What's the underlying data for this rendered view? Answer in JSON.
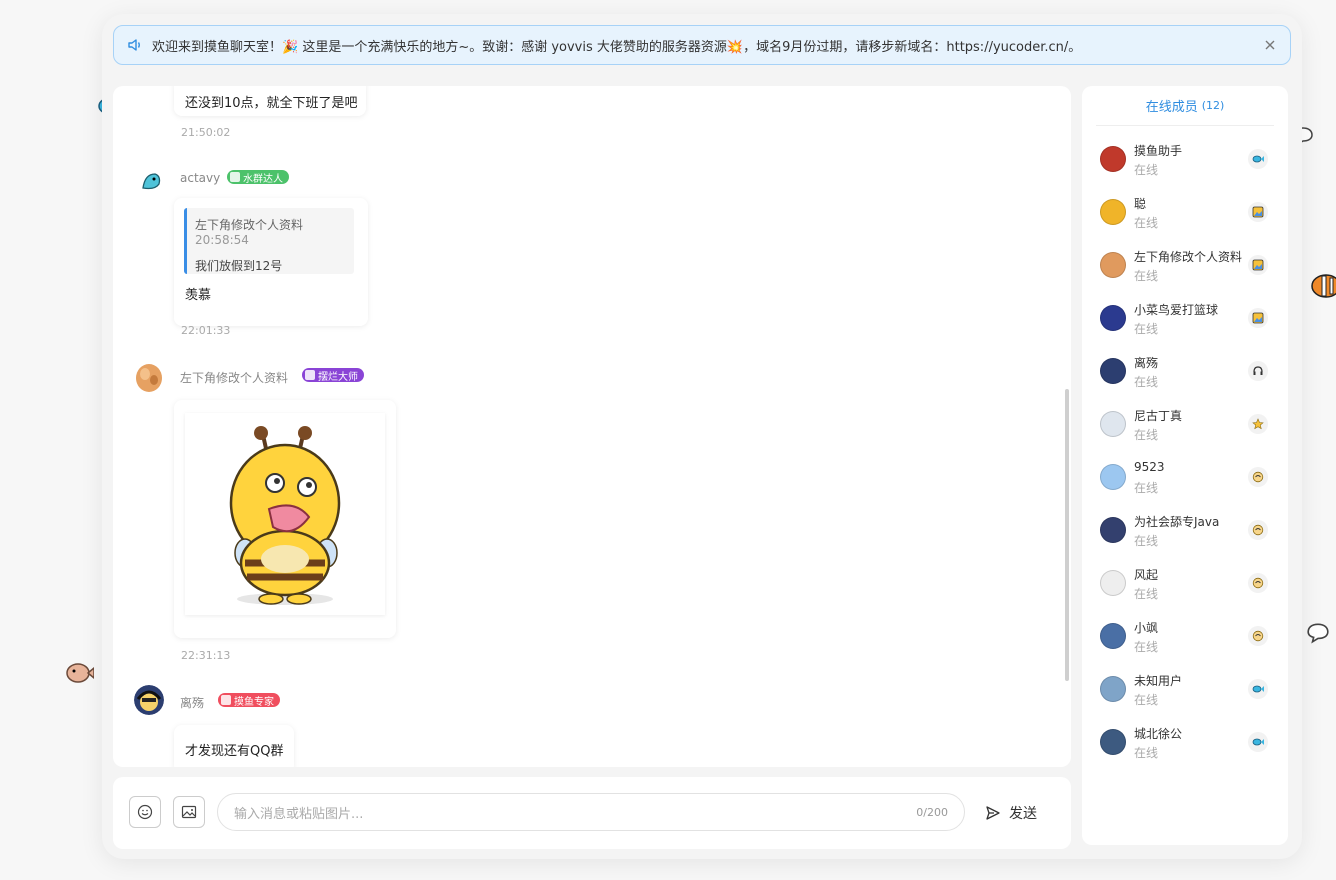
{
  "notice": {
    "text": "欢迎来到摸鱼聊天室！🎉 这里是一个充满快乐的地方~。致谢：感谢 yovvis 大佬赞助的服务器资源💥，域名9月份过期，请移步新域名：https://yucoder.cn/。"
  },
  "messages": {
    "m1": {
      "text": "还没到10点，就全下班了是吧",
      "time": "21:50:02"
    },
    "m2": {
      "user": "actavy",
      "badge": "水群达人",
      "badge_color": "#4cc26a",
      "quote_user": "左下角修改个人资料",
      "quote_time": "20:58:54",
      "quote_text": "我们放假到12号",
      "text": "羡慕",
      "time": "22:01:33"
    },
    "m3": {
      "user": "左下角修改个人资料",
      "badge": "摆烂大师",
      "badge_color": "#8a44d6",
      "image": "bee-sticker",
      "time": "22:31:13"
    },
    "m4": {
      "user": "离殇",
      "badge": "摸鱼专家",
      "badge_color": "#f04e5e",
      "text": "才发现还有QQ群"
    }
  },
  "composer": {
    "placeholder": "输入消息或粘贴图片...",
    "counter": "0/200",
    "send_label": "发送"
  },
  "members": {
    "title": "在线成员",
    "count": "(12)",
    "list": [
      {
        "name": "摸鱼助手",
        "status": "在线",
        "color": "#c0392b",
        "icon": "fish-icon"
      },
      {
        "name": "聪",
        "status": "在线",
        "color": "#f0b429",
        "icon": "picture-badge-icon"
      },
      {
        "name": "左下角修改个人资料",
        "status": "在线",
        "color": "#e09a5e",
        "icon": "picture-badge-icon"
      },
      {
        "name": "小菜鸟爱打篮球",
        "status": "在线",
        "color": "#2b3a8f",
        "icon": "picture-badge-icon"
      },
      {
        "name": "离殇",
        "status": "在线",
        "color": "#2c3e70",
        "icon": "headset-icon"
      },
      {
        "name": "尼古丁真",
        "status": "在线",
        "color": "#dfe6ee",
        "icon": "star-icon"
      },
      {
        "name": "9523",
        "status": "在线",
        "color": "#9cc7f0",
        "icon": "cookie-icon"
      },
      {
        "name": "为社会舔专Java",
        "status": "在线",
        "color": "#33406e",
        "icon": "cookie-icon"
      },
      {
        "name": "风起",
        "status": "在线",
        "color": "#eeeeee",
        "icon": "cookie-icon"
      },
      {
        "name": "小飒",
        "status": "在线",
        "color": "#4a6fa5",
        "icon": "cookie-icon"
      },
      {
        "name": "未知用户",
        "status": "在线",
        "color": "#7fa4c8",
        "icon": "fish-icon"
      },
      {
        "name": "城北徐公",
        "status": "在线",
        "color": "#3d5a80",
        "icon": "fish-icon"
      }
    ]
  }
}
